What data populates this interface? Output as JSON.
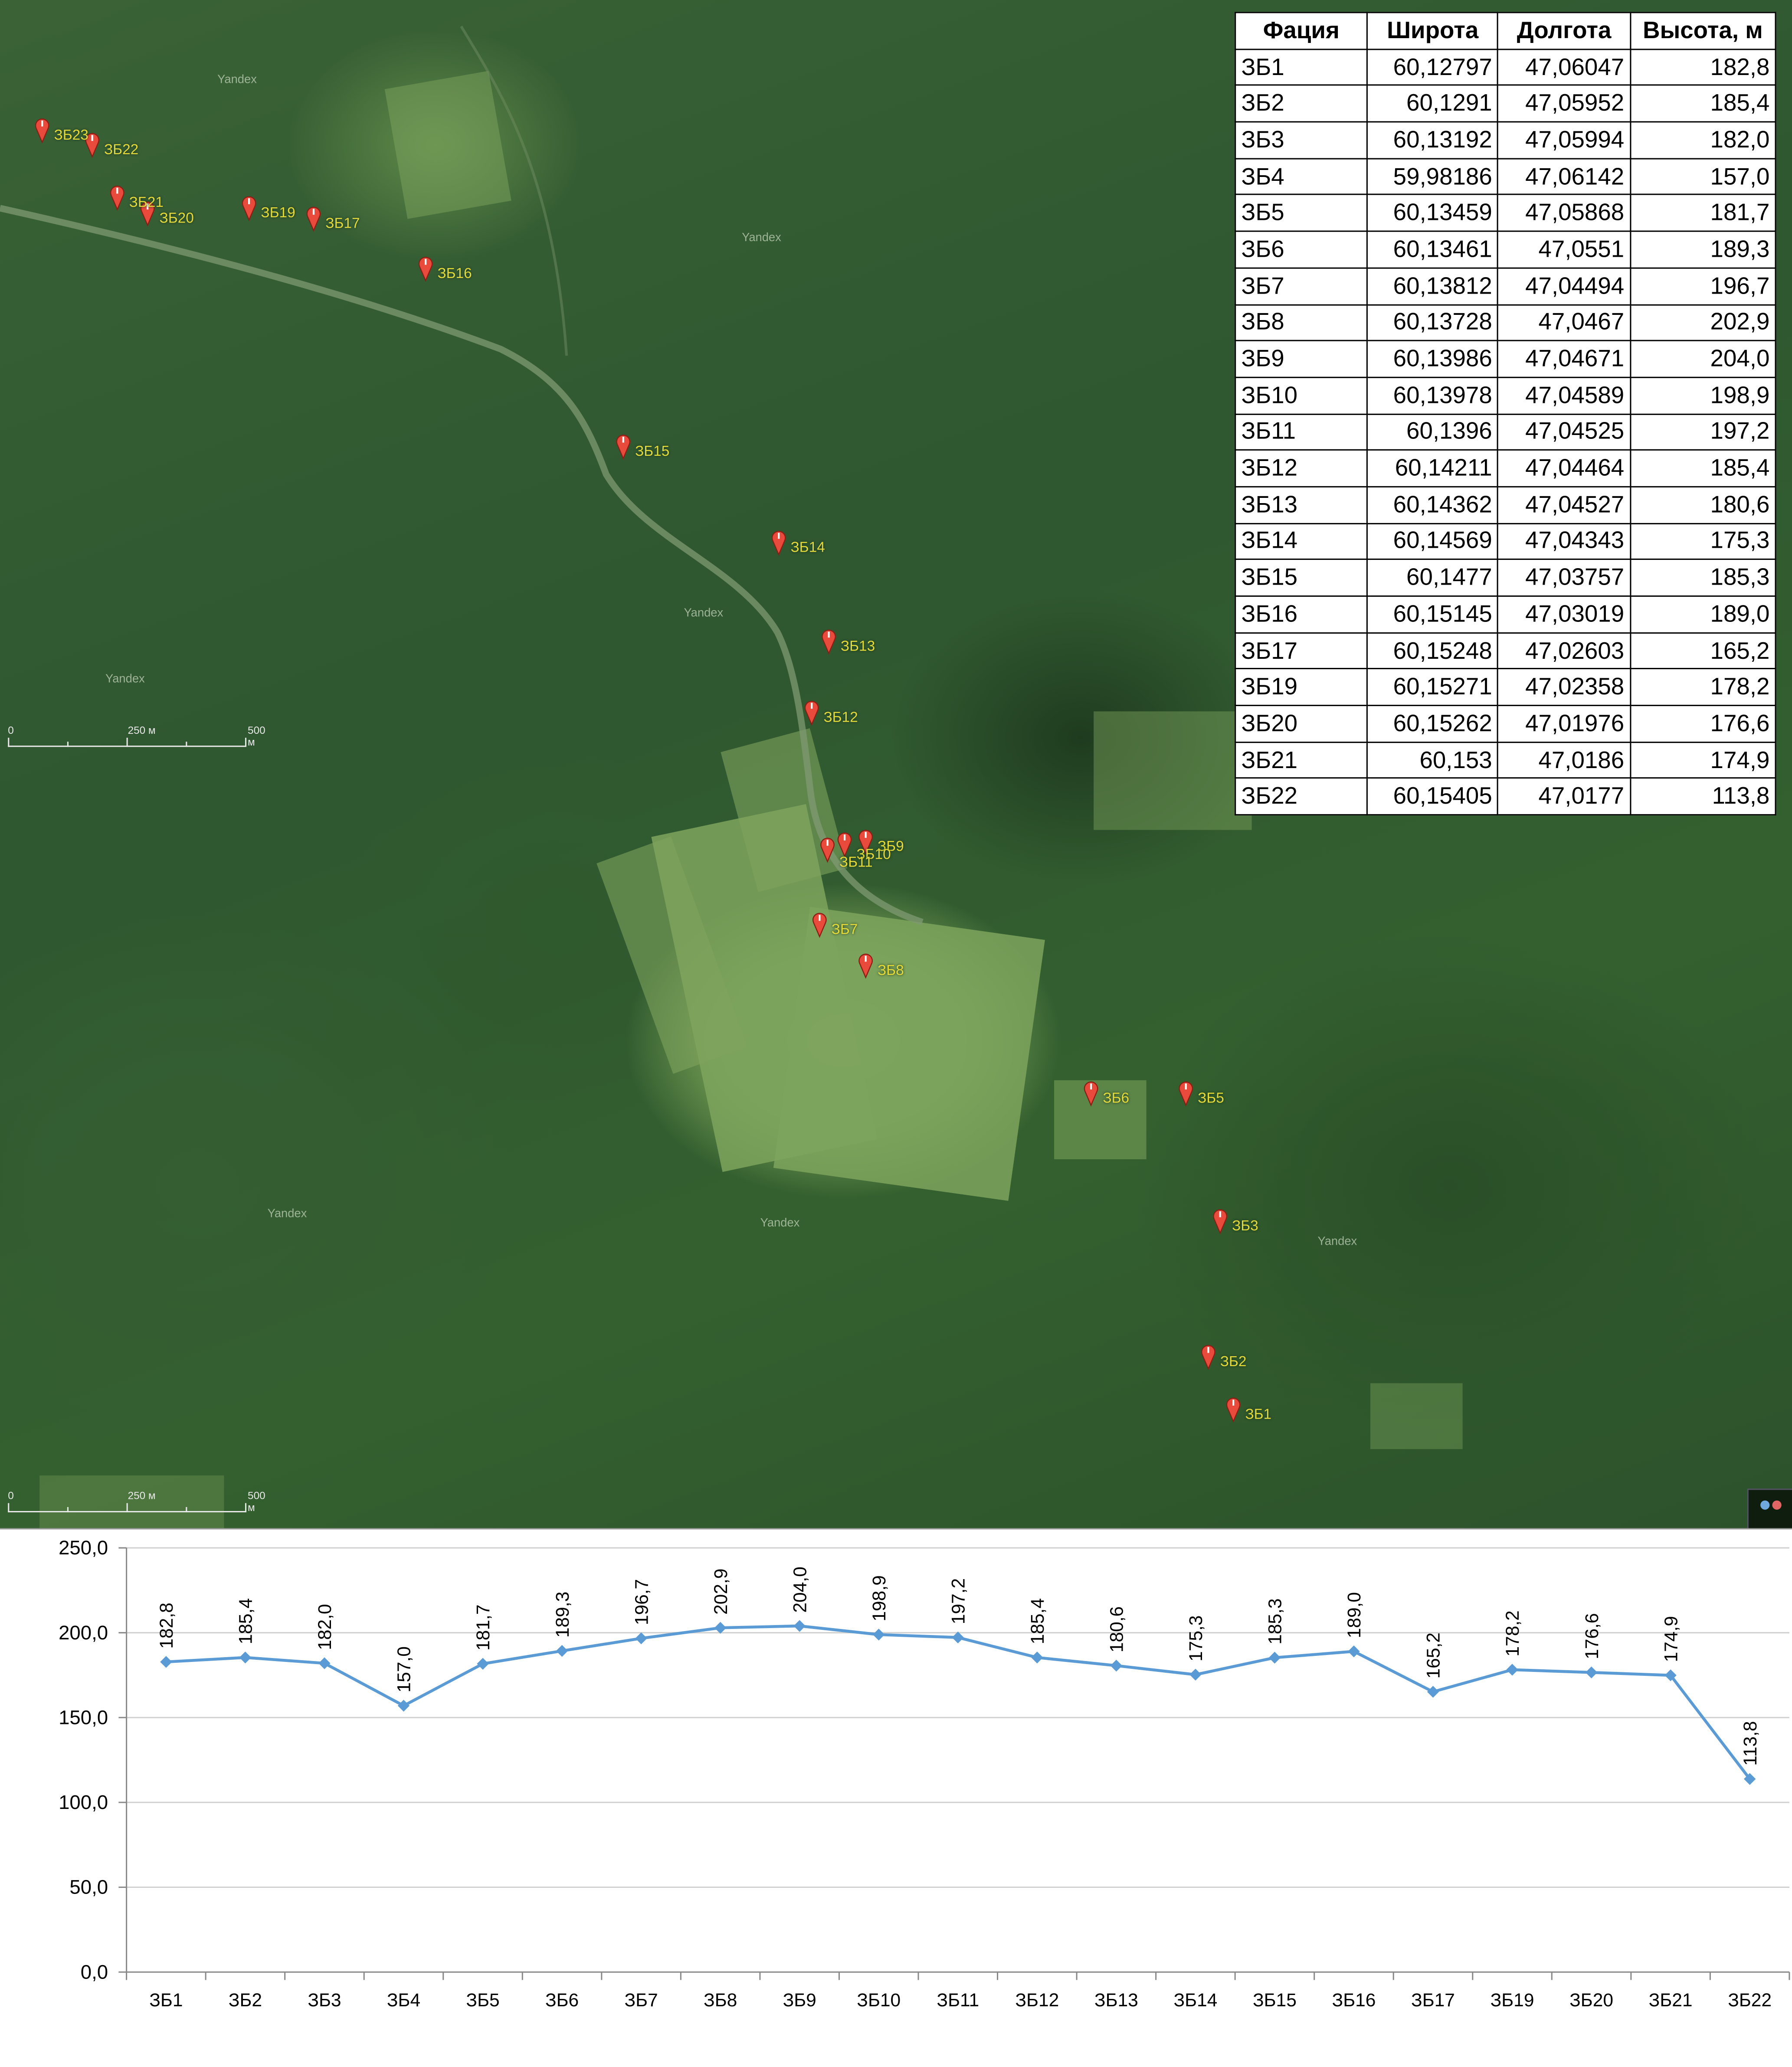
{
  "map": {
    "watermark": "Yandex",
    "scale_labels": [
      "0",
      "250 м",
      "500 м"
    ],
    "markers": [
      "ЗБ1",
      "ЗБ2",
      "ЗБ3",
      "ЗБ5",
      "ЗБ6",
      "ЗБ7",
      "ЗБ8",
      "ЗБ9",
      "ЗБ10",
      "ЗБ11",
      "ЗБ12",
      "ЗБ13",
      "ЗБ14",
      "ЗБ15",
      "ЗБ16",
      "ЗБ17",
      "ЗБ19",
      "ЗБ20",
      "ЗБ21",
      "ЗБ22",
      "ЗБ23"
    ],
    "colors": {
      "forest": "#2f5730",
      "clearing": "#7ea45d",
      "marker": "#e84a3c",
      "label": "#e3da3a"
    }
  },
  "table": {
    "headers": [
      "Фация",
      "Широта",
      "Долгота",
      "Высота, м"
    ],
    "rows": [
      [
        "ЗБ1",
        "60,12797",
        "47,06047",
        "182,8"
      ],
      [
        "ЗБ2",
        "60,1291",
        "47,05952",
        "185,4"
      ],
      [
        "ЗБ3",
        "60,13192",
        "47,05994",
        "182,0"
      ],
      [
        "ЗБ4",
        "59,98186",
        "47,06142",
        "157,0"
      ],
      [
        "ЗБ5",
        "60,13459",
        "47,05868",
        "181,7"
      ],
      [
        "ЗБ6",
        "60,13461",
        "47,0551",
        "189,3"
      ],
      [
        "ЗБ7",
        "60,13812",
        "47,04494",
        "196,7"
      ],
      [
        "ЗБ8",
        "60,13728",
        "47,0467",
        "202,9"
      ],
      [
        "ЗБ9",
        "60,13986",
        "47,04671",
        "204,0"
      ],
      [
        "ЗБ10",
        "60,13978",
        "47,04589",
        "198,9"
      ],
      [
        "ЗБ11",
        "60,1396",
        "47,04525",
        "197,2"
      ],
      [
        "ЗБ12",
        "60,14211",
        "47,04464",
        "185,4"
      ],
      [
        "ЗБ13",
        "60,14362",
        "47,04527",
        "180,6"
      ],
      [
        "ЗБ14",
        "60,14569",
        "47,04343",
        "175,3"
      ],
      [
        "ЗБ15",
        "60,1477",
        "47,03757",
        "185,3"
      ],
      [
        "ЗБ16",
        "60,15145",
        "47,03019",
        "189,0"
      ],
      [
        "ЗБ17",
        "60,15248",
        "47,02603",
        "165,2"
      ],
      [
        "ЗБ19",
        "60,15271",
        "47,02358",
        "178,2"
      ],
      [
        "ЗБ20",
        "60,15262",
        "47,01976",
        "176,6"
      ],
      [
        "ЗБ21",
        "60,153",
        "47,0186",
        "174,9"
      ],
      [
        "ЗБ22",
        "60,15405",
        "47,0177",
        "113,8"
      ]
    ]
  },
  "chart_data": {
    "type": "line",
    "categories": [
      "ЗБ1",
      "ЗБ2",
      "ЗБ3",
      "ЗБ4",
      "ЗБ5",
      "ЗБ6",
      "ЗБ7",
      "ЗБ8",
      "ЗБ9",
      "ЗБ10",
      "ЗБ11",
      "ЗБ12",
      "ЗБ13",
      "ЗБ14",
      "ЗБ15",
      "ЗБ16",
      "ЗБ17",
      "ЗБ19",
      "ЗБ20",
      "ЗБ21",
      "ЗБ22"
    ],
    "values": [
      182.8,
      185.4,
      182.0,
      157.0,
      181.7,
      189.3,
      196.7,
      202.9,
      204.0,
      198.9,
      197.2,
      185.4,
      180.6,
      175.3,
      185.3,
      189.0,
      165.2,
      178.2,
      176.6,
      174.9,
      113.8
    ],
    "data_labels": [
      "182,8",
      "185,4",
      "182,0",
      "157,0",
      "181,7",
      "189,3",
      "196,7",
      "202,9",
      "204,0",
      "198,9",
      "197,2",
      "185,4",
      "180,6",
      "175,3",
      "185,3",
      "189,0",
      "165,2",
      "178,2",
      "176,6",
      "174,9",
      "113,8"
    ],
    "yticks": [
      "0,0",
      "50,0",
      "100,0",
      "150,0",
      "200,0",
      "250,0"
    ],
    "ylim": [
      0,
      250
    ],
    "grid": true,
    "legend": "none",
    "line_color": "#5b9bd5",
    "marker": "diamond",
    "title": "",
    "xlabel": "",
    "ylabel": ""
  }
}
